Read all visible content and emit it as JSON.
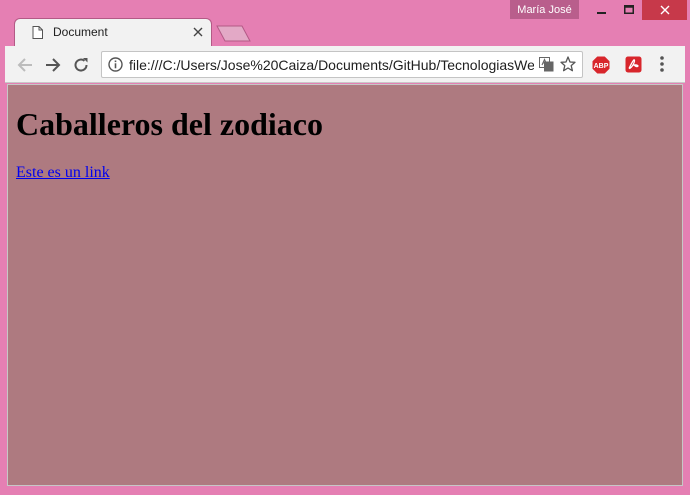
{
  "window": {
    "profile_name": "María José",
    "close_color": "#c7394a"
  },
  "tab": {
    "title": "Document",
    "icon": "document-icon"
  },
  "toolbar": {
    "url": "file:///C:/Users/Jose%20Caiza/Documents/GitHub/TecnologiasWeb",
    "icons": [
      "back-arrow-icon",
      "forward-arrow-icon",
      "reload-icon",
      "info-icon",
      "translate-icon",
      "star-icon",
      "adblock-plus-icon",
      "pdf-extension-icon",
      "menu-icon"
    ],
    "abp_label": "ABP"
  },
  "page": {
    "heading": "Caballeros del zodiaco",
    "link_text": "Este es un link",
    "background_color": "#ae7a80",
    "link_color": "#0000ee"
  }
}
